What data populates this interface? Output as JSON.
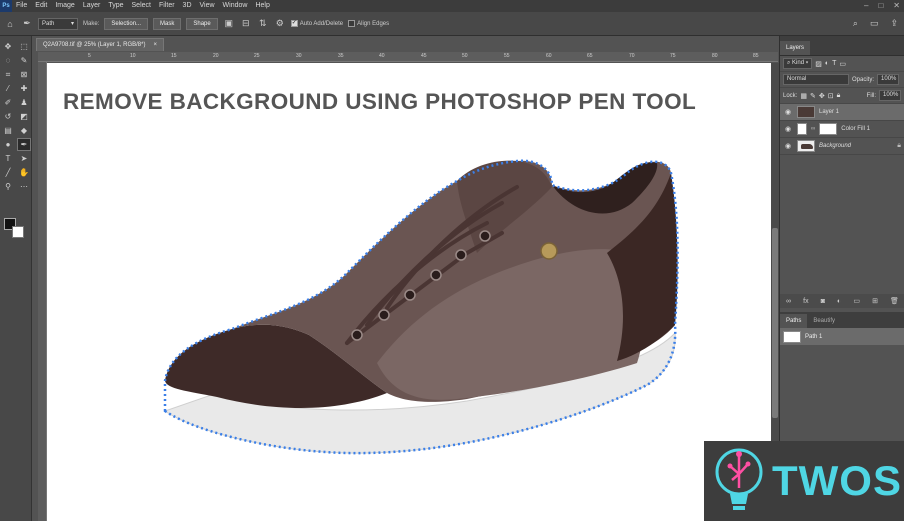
{
  "menu": {
    "logo": "Ps",
    "items": [
      "File",
      "Edit",
      "Image",
      "Layer",
      "Type",
      "Select",
      "Filter",
      "3D",
      "View",
      "Window",
      "Help"
    ],
    "window_controls": [
      "–",
      "□",
      "✕"
    ]
  },
  "options_bar": {
    "mode_value": "Path",
    "make_label": "Make:",
    "selection_button": "Selection...",
    "mask_button": "Mask",
    "shape_button": "Shape",
    "auto_add_delete_label": "Auto Add/Delete",
    "auto_add_delete_checked": true,
    "align_edges_label": "Align Edges",
    "align_edges_checked": false
  },
  "document": {
    "tab_title": "Q2A9708.tif @ 25% (Layer 1, RGB/8*)",
    "tab_close": "×",
    "ruler_ticks": [
      "5",
      "10",
      "15",
      "20",
      "25",
      "30",
      "35",
      "40",
      "45",
      "50",
      "55",
      "60",
      "65",
      "70",
      "75",
      "80",
      "85"
    ]
  },
  "canvas": {
    "title": "REMOVE BACKGROUND USING PHOTOSHOP PEN TOOL",
    "path_color": "#3a7fe8"
  },
  "layers_panel": {
    "tab_label": "Layers",
    "kind_filter": "Kind",
    "blend_mode": "Normal",
    "opacity_label": "Opacity:",
    "opacity_value": "100%",
    "lock_label": "Lock:",
    "fill_label": "Fill:",
    "fill_value": "100%",
    "layers": [
      {
        "name": "Layer 1",
        "selected": true
      },
      {
        "name": "Color Fill 1",
        "selected": false
      },
      {
        "name": "Background",
        "selected": false,
        "locked": true
      }
    ]
  },
  "paths_panel": {
    "tabs": [
      "Paths",
      "Beautify"
    ],
    "paths": [
      "Path 1"
    ]
  },
  "watermark": {
    "text": "TWOS",
    "accent": "#4fd6e4"
  }
}
